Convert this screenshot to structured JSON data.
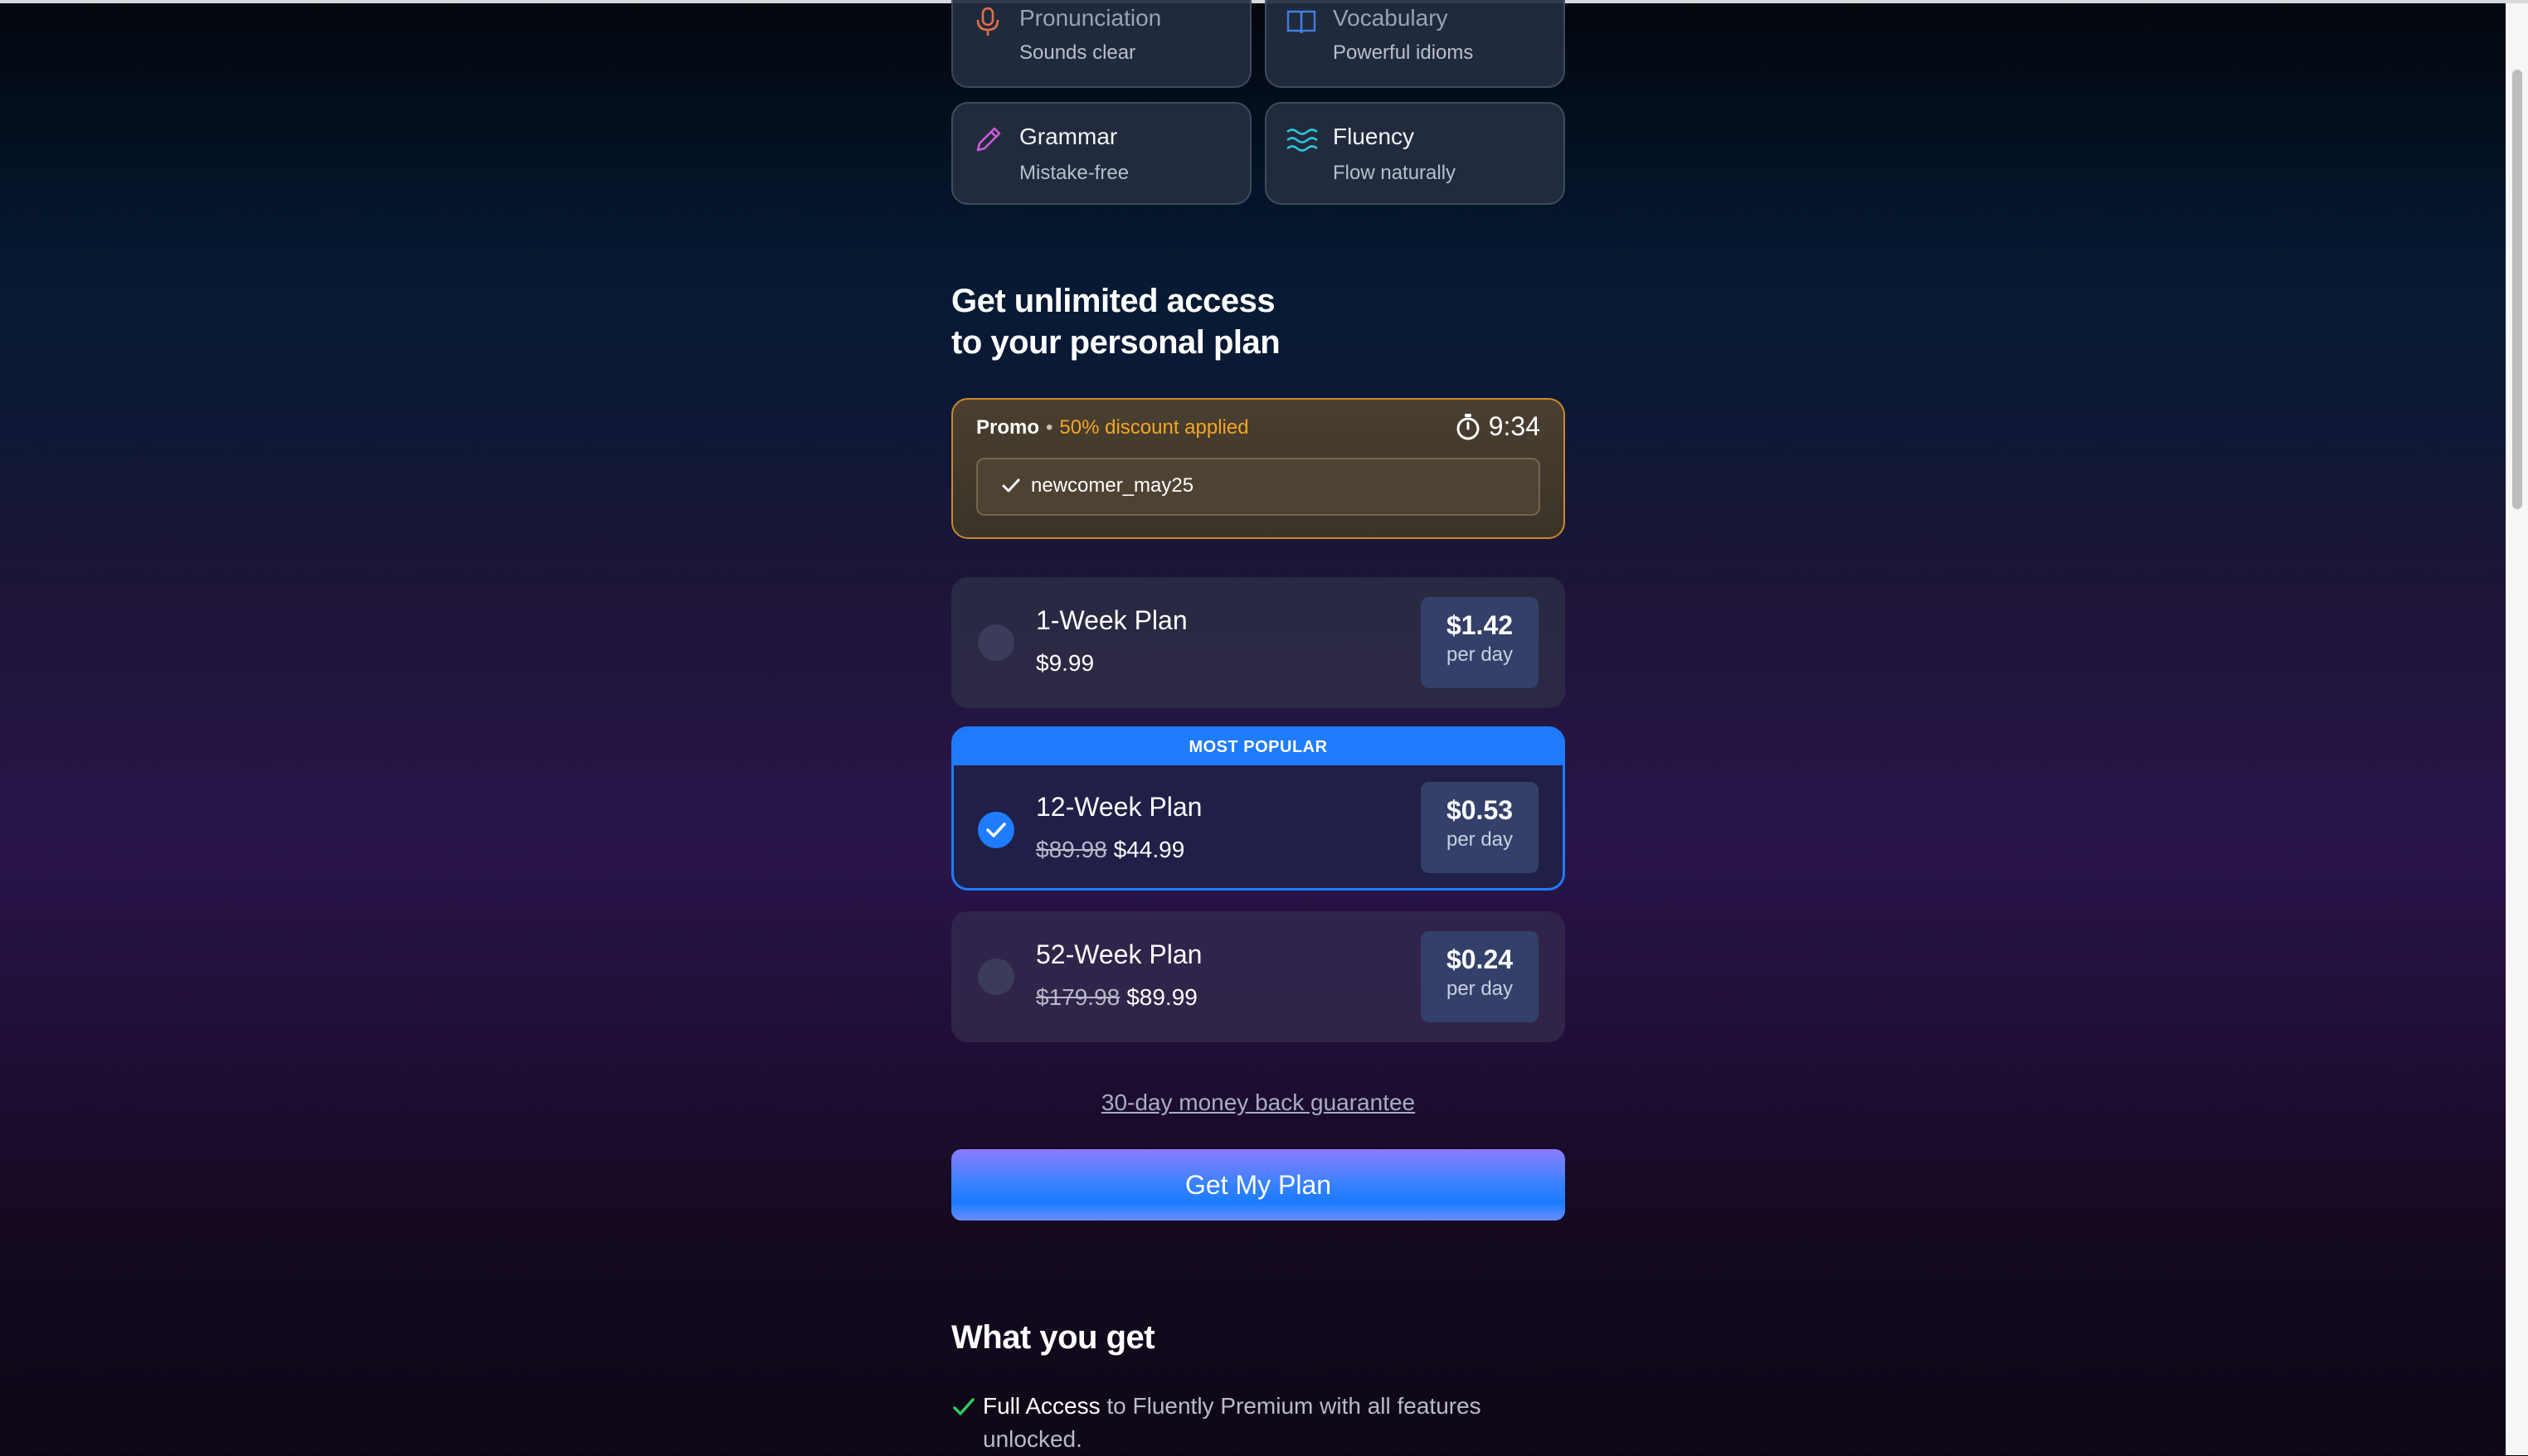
{
  "features": [
    {
      "title": "Pronunciation",
      "subtitle": "Sounds clear",
      "icon": "microphone-icon",
      "icon_color": "#e0704a"
    },
    {
      "title": "Vocabulary",
      "subtitle": "Powerful idioms",
      "icon": "open-book-icon",
      "icon_color": "#3f7fe0"
    },
    {
      "title": "Grammar",
      "subtitle": "Mistake-free",
      "icon": "pencil-icon",
      "icon_color": "#d05ad8"
    },
    {
      "title": "Fluency",
      "subtitle": "Flow naturally",
      "icon": "waves-icon",
      "icon_color": "#2fc2d8"
    }
  ],
  "offer": {
    "heading_line1": "Get unlimited access",
    "heading_line2": "to your personal plan"
  },
  "promo": {
    "label": "Promo",
    "separator": "•",
    "discount": "50% discount applied",
    "timer": "9:34",
    "code": "newcomer_may25",
    "border_color": "#c9892c",
    "discount_color": "#f5a623"
  },
  "plans": [
    {
      "name": "1-Week Plan",
      "old_price": "",
      "price": "$9.99",
      "per_day": "$1.42",
      "per_day_unit": "per day",
      "selected": false,
      "badge": ""
    },
    {
      "name": "12-Week Plan",
      "old_price": "$89.98",
      "price": "$44.99",
      "per_day": "$0.53",
      "per_day_unit": "per day",
      "selected": true,
      "badge": "MOST POPULAR"
    },
    {
      "name": "52-Week Plan",
      "old_price": "$179.98",
      "price": "$89.99",
      "per_day": "$0.24",
      "per_day_unit": "per day",
      "selected": false,
      "badge": ""
    }
  ],
  "guarantee_link": "30-day money back guarantee",
  "cta_label": "Get My Plan",
  "what_you_get": {
    "heading": "What you get",
    "items": [
      {
        "strong": "Full Access",
        "rest": " to Fluently Premium with all features unlocked."
      }
    ]
  },
  "colors": {
    "accent_blue": "#1f7cff",
    "check_green": "#34c759"
  }
}
